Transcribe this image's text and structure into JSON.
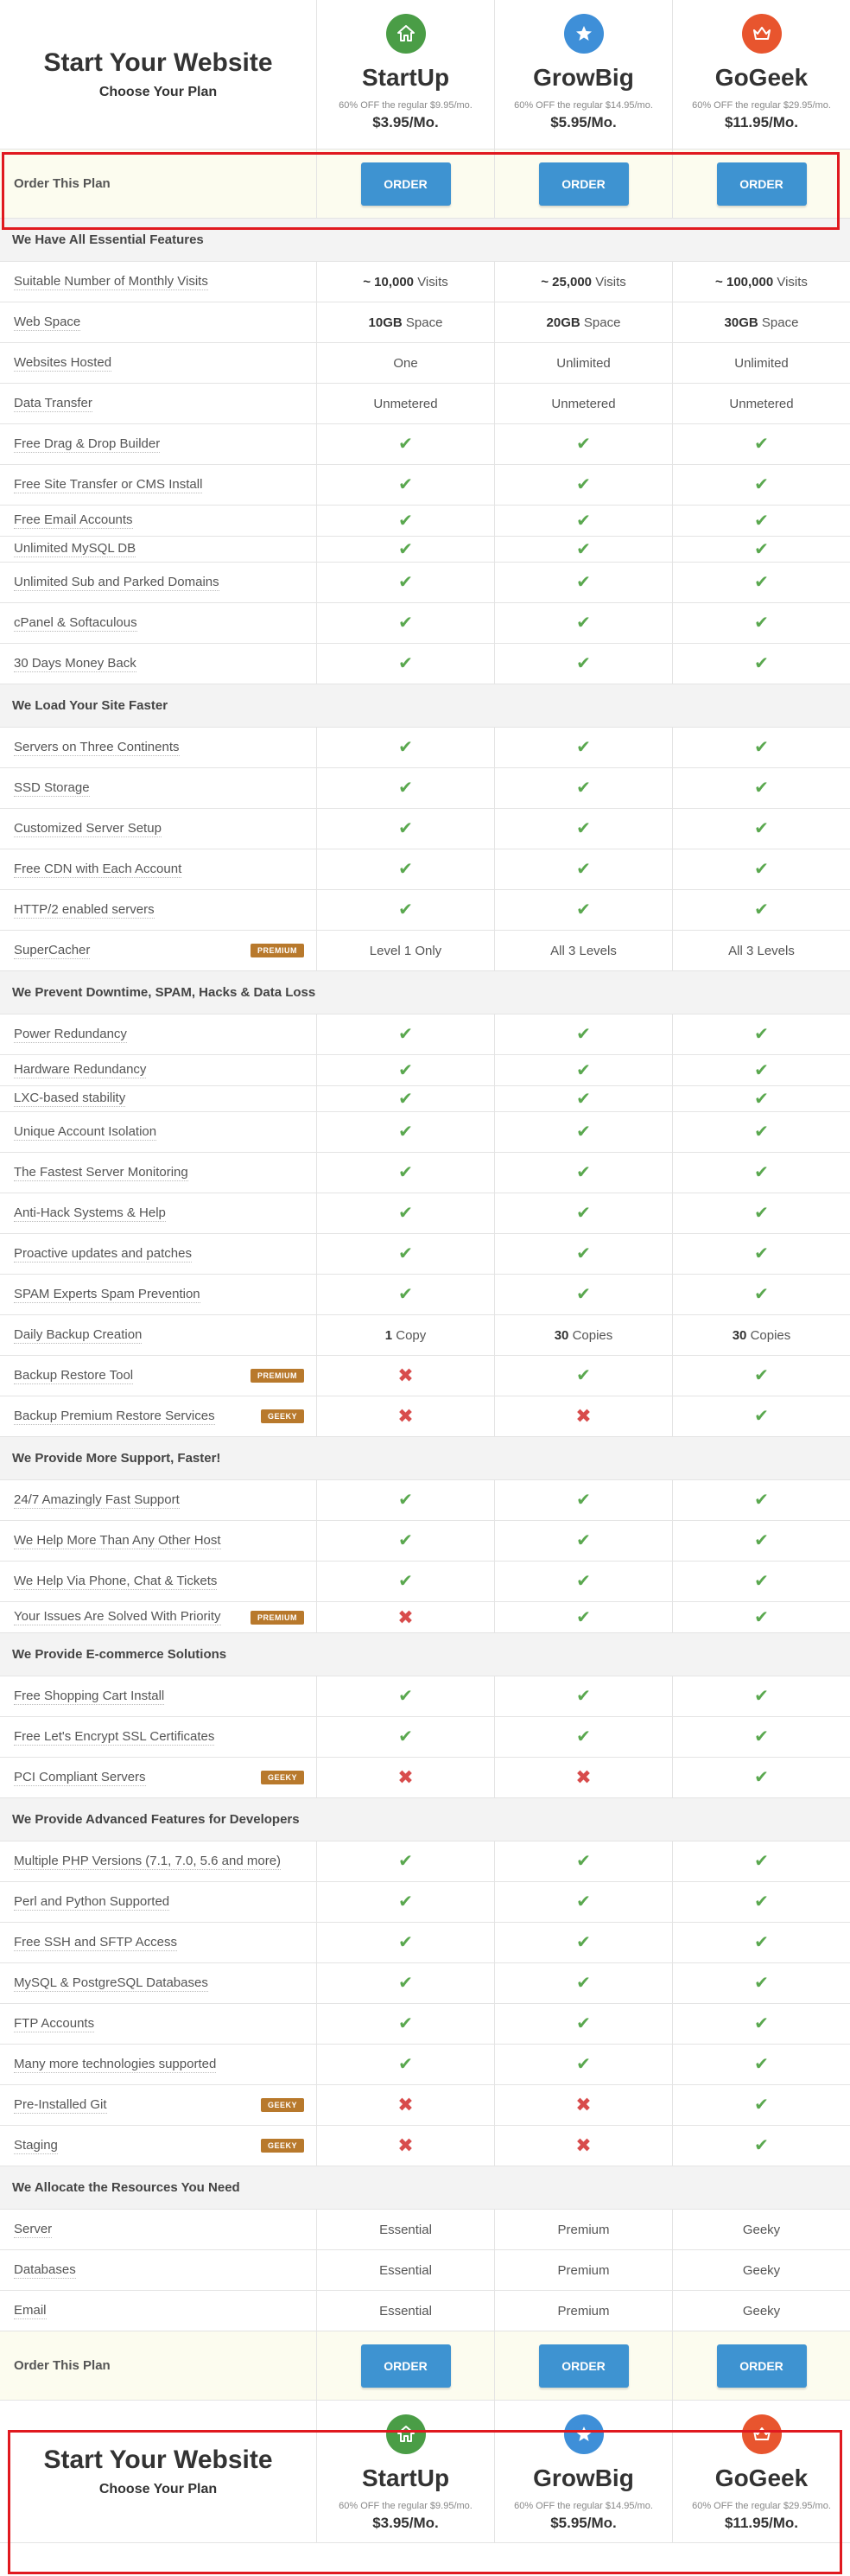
{
  "header": {
    "title": "Start Your Website",
    "subtitle": "Choose Your Plan",
    "plans": [
      {
        "name": "StartUp",
        "discount": "60% OFF the regular $9.95/mo.",
        "price": "$3.95/Mo.",
        "icon": "home-icon",
        "color": "#4a9d46"
      },
      {
        "name": "GrowBig",
        "discount": "60% OFF the regular $14.95/mo.",
        "price": "$5.95/Mo.",
        "icon": "star-icon",
        "color": "#3e8fd8"
      },
      {
        "name": "GoGeek",
        "discount": "60% OFF the regular $29.95/mo.",
        "price": "$11.95/Mo.",
        "icon": "crown-icon",
        "color": "#e8552e"
      }
    ]
  },
  "order": {
    "label": "Order This Plan",
    "button": "ORDER"
  },
  "sections": [
    {
      "title": "We Have All Essential Features",
      "rows": [
        {
          "label": "Suitable Number of Monthly Visits",
          "cells": [
            [
              "~ 10,000",
              " Visits"
            ],
            [
              "~ 25,000",
              " Visits"
            ],
            [
              "~ 100,000",
              " Visits"
            ]
          ]
        },
        {
          "label": "Web Space",
          "cells": [
            [
              "10GB",
              " Space"
            ],
            [
              "20GB",
              " Space"
            ],
            [
              "30GB",
              " Space"
            ]
          ]
        },
        {
          "label": "Websites Hosted",
          "cells": [
            "One",
            "Unlimited",
            "Unlimited"
          ]
        },
        {
          "label": "Data Transfer",
          "cells": [
            "Unmetered",
            "Unmetered",
            "Unmetered"
          ]
        },
        {
          "label": "Free Drag & Drop Builder",
          "cells": [
            "check",
            "check",
            "check"
          ]
        },
        {
          "label": "Free Site Transfer or CMS Install",
          "cells": [
            "check",
            "check",
            "check"
          ]
        },
        {
          "label": "Free Email Accounts",
          "cells": [
            "check",
            "check",
            "check"
          ],
          "short": true
        },
        {
          "label": "Unlimited MySQL DB",
          "cells": [
            "check",
            "check",
            "check"
          ],
          "tiny": true
        },
        {
          "label": "Unlimited Sub and Parked Domains",
          "cells": [
            "check",
            "check",
            "check"
          ]
        },
        {
          "label": "cPanel & Softaculous",
          "cells": [
            "check",
            "check",
            "check"
          ]
        },
        {
          "label": "30 Days Money Back",
          "cells": [
            "check",
            "check",
            "check"
          ]
        }
      ]
    },
    {
      "title": "We Load Your Site Faster",
      "rows": [
        {
          "label": "Servers on Three Continents",
          "cells": [
            "check",
            "check",
            "check"
          ]
        },
        {
          "label": "SSD Storage",
          "cells": [
            "check",
            "check",
            "check"
          ]
        },
        {
          "label": "Customized Server Setup",
          "cells": [
            "check",
            "check",
            "check"
          ]
        },
        {
          "label": "Free CDN with Each Account",
          "cells": [
            "check",
            "check",
            "check"
          ]
        },
        {
          "label": "HTTP/2 enabled servers",
          "cells": [
            "check",
            "check",
            "check"
          ]
        },
        {
          "label": "SuperCacher",
          "badge": "PREMIUM",
          "cells": [
            "Level 1 Only",
            "All 3 Levels",
            "All 3 Levels"
          ]
        }
      ]
    },
    {
      "title": "We Prevent Downtime, SPAM, Hacks & Data Loss",
      "rows": [
        {
          "label": "Power Redundancy",
          "cells": [
            "check",
            "check",
            "check"
          ]
        },
        {
          "label": "Hardware Redundancy",
          "cells": [
            "check",
            "check",
            "check"
          ],
          "short": true
        },
        {
          "label": "LXC-based stability",
          "cells": [
            "check",
            "check",
            "check"
          ],
          "tiny": true
        },
        {
          "label": "Unique Account Isolation",
          "cells": [
            "check",
            "check",
            "check"
          ]
        },
        {
          "label": "The Fastest Server Monitoring",
          "cells": [
            "check",
            "check",
            "check"
          ]
        },
        {
          "label": "Anti-Hack Systems & Help",
          "cells": [
            "check",
            "check",
            "check"
          ]
        },
        {
          "label": "Proactive updates and patches",
          "cells": [
            "check",
            "check",
            "check"
          ]
        },
        {
          "label": "SPAM Experts Spam Prevention",
          "cells": [
            "check",
            "check",
            "check"
          ]
        },
        {
          "label": "Daily Backup Creation",
          "cells": [
            [
              "1",
              " Copy"
            ],
            [
              "30",
              " Copies"
            ],
            [
              "30",
              " Copies"
            ]
          ]
        },
        {
          "label": "Backup Restore Tool",
          "badge": "PREMIUM",
          "cells": [
            "cross",
            "check",
            "check"
          ]
        },
        {
          "label": "Backup Premium Restore Services",
          "badge": "GEEKY",
          "cells": [
            "cross",
            "cross",
            "check"
          ]
        }
      ]
    },
    {
      "title": "We Provide More Support, Faster!",
      "rows": [
        {
          "label": "24/7 Amazingly Fast Support",
          "cells": [
            "check",
            "check",
            "check"
          ]
        },
        {
          "label": "We Help More Than Any Other Host",
          "cells": [
            "check",
            "check",
            "check"
          ]
        },
        {
          "label": "We Help Via Phone, Chat & Tickets",
          "cells": [
            "check",
            "check",
            "check"
          ]
        },
        {
          "label": "Your Issues Are Solved With Priority",
          "badge": "PREMIUM",
          "cells": [
            "cross",
            "check",
            "check"
          ],
          "short": true
        }
      ]
    },
    {
      "title": "We Provide E-commerce Solutions",
      "rows": [
        {
          "label": "Free Shopping Cart Install",
          "cells": [
            "check",
            "check",
            "check"
          ]
        },
        {
          "label": "Free Let's Encrypt SSL Certificates",
          "cells": [
            "check",
            "check",
            "check"
          ]
        },
        {
          "label": "PCI Compliant Servers",
          "badge": "GEEKY",
          "cells": [
            "cross",
            "cross",
            "check"
          ]
        }
      ]
    },
    {
      "title": "We Provide Advanced Features for Developers",
      "rows": [
        {
          "label": "Multiple PHP Versions (7.1, 7.0, 5.6 and more)",
          "cells": [
            "check",
            "check",
            "check"
          ]
        },
        {
          "label": "Perl and Python Supported",
          "cells": [
            "check",
            "check",
            "check"
          ]
        },
        {
          "label": "Free SSH and SFTP Access",
          "cells": [
            "check",
            "check",
            "check"
          ]
        },
        {
          "label": "MySQL & PostgreSQL Databases",
          "cells": [
            "check",
            "check",
            "check"
          ]
        },
        {
          "label": "FTP Accounts",
          "cells": [
            "check",
            "check",
            "check"
          ]
        },
        {
          "label": "Many more technologies supported",
          "cells": [
            "check",
            "check",
            "check"
          ]
        },
        {
          "label": "Pre-Installed Git",
          "badge": "GEEKY",
          "cells": [
            "cross",
            "cross",
            "check"
          ]
        },
        {
          "label": "Staging",
          "badge": "GEEKY",
          "cells": [
            "cross",
            "cross",
            "check"
          ]
        }
      ]
    },
    {
      "title": "We Allocate the Resources You Need",
      "rows": [
        {
          "label": "Server",
          "cells": [
            "Essential",
            "Premium",
            "Geeky"
          ]
        },
        {
          "label": "Databases",
          "cells": [
            "Essential",
            "Premium",
            "Geeky"
          ]
        },
        {
          "label": "Email",
          "cells": [
            "Essential",
            "Premium",
            "Geeky"
          ]
        }
      ]
    }
  ]
}
